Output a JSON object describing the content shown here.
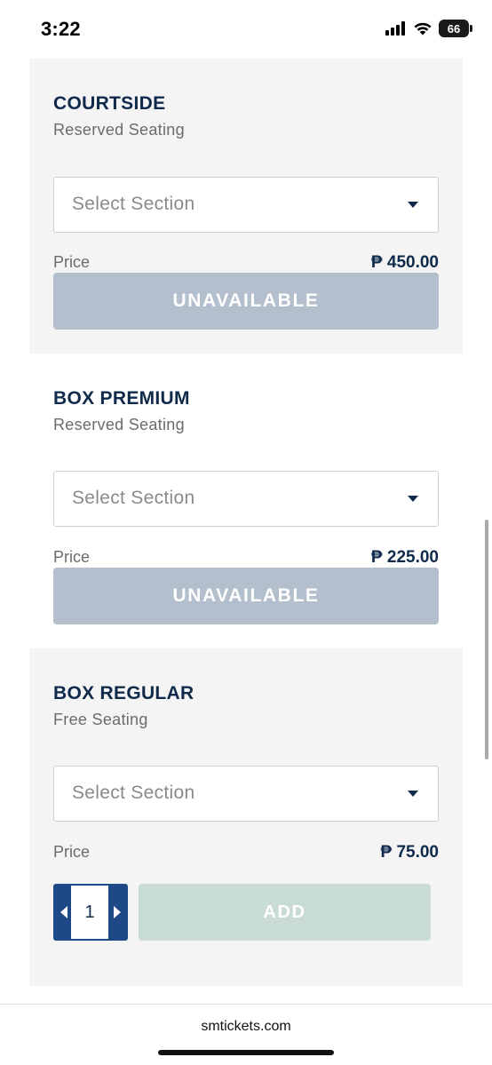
{
  "status_bar": {
    "time": "3:22",
    "battery_level": "66",
    "icons": [
      "signal-icon",
      "wifi-icon",
      "battery-icon"
    ]
  },
  "tickets": [
    {
      "title": "COURTSIDE",
      "subtitle": "Reserved Seating",
      "select_placeholder": "Select Section",
      "price_label": "Price",
      "price": "₱ 450.00",
      "action_label": "UNAVAILABLE"
    },
    {
      "title": "BOX PREMIUM",
      "subtitle": "Reserved Seating",
      "select_placeholder": "Select Section",
      "price_label": "Price",
      "price": "₱ 225.00",
      "action_label": "UNAVAILABLE"
    },
    {
      "title": "BOX REGULAR",
      "subtitle": "Free Seating",
      "select_placeholder": "Select Section",
      "price_label": "Price",
      "price": "₱ 75.00",
      "quantity": "1",
      "action_label": "ADD"
    }
  ],
  "browser": {
    "url": "smtickets.com"
  },
  "colors": {
    "navy": "#0f2a4a",
    "stepper_blue": "#1d4a86",
    "unavailable_grey": "#b3bfcd",
    "add_disabled": "#c9dbd7",
    "card_grey": "#f4f4f4"
  }
}
